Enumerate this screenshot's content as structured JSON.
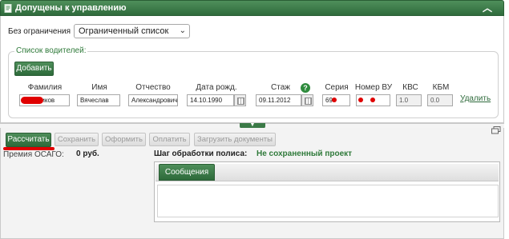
{
  "header": {
    "title": "Допущены к управлению",
    "collapse_icon": "chevron-up-icon"
  },
  "restriction": {
    "label": "Без ограничения",
    "selected": "Ограниченный список"
  },
  "drivers": {
    "legend": "Список водителей:",
    "add_label": "Добавить",
    "columns": {
      "surname": "Фамилия",
      "name": "Имя",
      "patronymic": "Отчество",
      "birth_date": "Дата рожд.",
      "experience": "Стаж",
      "series": "Серия",
      "license_no": "Номер ВУ",
      "kvs": "КВС",
      "kbm": "КБМ"
    },
    "row": {
      "surname": "ников",
      "name": "Вячеслав",
      "patronymic": "Александрович",
      "birth_date": "14.10.1990",
      "experience": "09.11.2012",
      "series": "69",
      "license_no": "",
      "kvs": "1.0",
      "kbm": "0.0",
      "delete_label": "Удалить"
    },
    "help_icon": "?"
  },
  "toolbar": {
    "calculate": "Рассчитать",
    "save": "Сохранить",
    "issue": "Оформить",
    "pay": "Оплатить",
    "upload": "Загрузить документы"
  },
  "premium": {
    "label": "Премия ОСАГО:",
    "value": "0 руб."
  },
  "step": {
    "label": "Шаг обработки полиса:",
    "value": "Не сохраненный проект"
  },
  "messages": {
    "tab": "Сообщения"
  },
  "colors": {
    "accent": "#2d6a3a",
    "step_value": "#2f7a3a",
    "redaction": "#e00000"
  }
}
